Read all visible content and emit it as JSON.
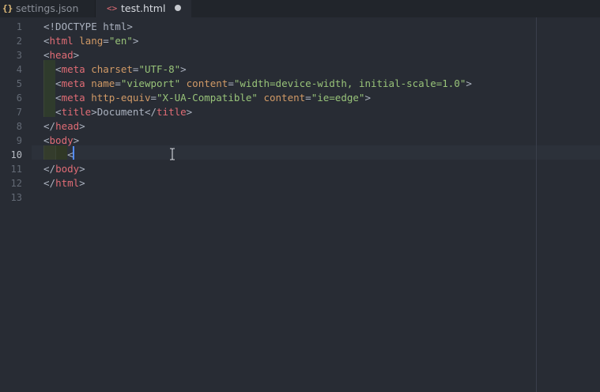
{
  "tabs": [
    {
      "label": "settings.json",
      "icon": "{}",
      "icon_name": "json-braces-icon",
      "active": false
    },
    {
      "label": "test.html",
      "icon": "<>",
      "icon_name": "html-code-icon",
      "active": true,
      "modified_indicator": "dirty-dot-icon"
    }
  ],
  "editor": {
    "active_line": 10,
    "line_numbers": [
      "1",
      "2",
      "3",
      "4",
      "5",
      "6",
      "7",
      "8",
      "9",
      "10",
      "11",
      "12",
      "13"
    ],
    "lines": [
      [
        {
          "c": "punct",
          "t": "<!DOCTYPE html>"
        }
      ],
      [
        {
          "c": "punct",
          "t": "<"
        },
        {
          "c": "tag",
          "t": "html"
        },
        {
          "c": "punct",
          "t": " "
        },
        {
          "c": "attr",
          "t": "lang"
        },
        {
          "c": "punct",
          "t": "="
        },
        {
          "c": "str",
          "t": "\"en\""
        },
        {
          "c": "punct",
          "t": ">"
        }
      ],
      [
        {
          "c": "punct",
          "t": "<"
        },
        {
          "c": "tag",
          "t": "head"
        },
        {
          "c": "punct",
          "t": ">"
        }
      ],
      [
        {
          "c": "punct",
          "t": "  <"
        },
        {
          "c": "tag",
          "t": "meta"
        },
        {
          "c": "punct",
          "t": " "
        },
        {
          "c": "attr",
          "t": "charset"
        },
        {
          "c": "punct",
          "t": "="
        },
        {
          "c": "str",
          "t": "\"UTF-8\""
        },
        {
          "c": "punct",
          "t": ">"
        }
      ],
      [
        {
          "c": "punct",
          "t": "  <"
        },
        {
          "c": "tag",
          "t": "meta"
        },
        {
          "c": "punct",
          "t": " "
        },
        {
          "c": "attr",
          "t": "name"
        },
        {
          "c": "punct",
          "t": "="
        },
        {
          "c": "str",
          "t": "\"viewport\""
        },
        {
          "c": "punct",
          "t": " "
        },
        {
          "c": "attr",
          "t": "content"
        },
        {
          "c": "punct",
          "t": "="
        },
        {
          "c": "str",
          "t": "\"width=device-width, initial-scale=1.0\""
        },
        {
          "c": "punct",
          "t": ">"
        }
      ],
      [
        {
          "c": "punct",
          "t": "  <"
        },
        {
          "c": "tag",
          "t": "meta"
        },
        {
          "c": "punct",
          "t": " "
        },
        {
          "c": "attr",
          "t": "http-equiv"
        },
        {
          "c": "punct",
          "t": "="
        },
        {
          "c": "str",
          "t": "\"X-UA-Compatible\""
        },
        {
          "c": "punct",
          "t": " "
        },
        {
          "c": "attr",
          "t": "content"
        },
        {
          "c": "punct",
          "t": "="
        },
        {
          "c": "str",
          "t": "\"ie=edge\""
        },
        {
          "c": "punct",
          "t": ">"
        }
      ],
      [
        {
          "c": "punct",
          "t": "  <"
        },
        {
          "c": "tag",
          "t": "title"
        },
        {
          "c": "punct",
          "t": ">"
        },
        {
          "c": "txt",
          "t": "Document"
        },
        {
          "c": "punct",
          "t": "</"
        },
        {
          "c": "tag",
          "t": "title"
        },
        {
          "c": "punct",
          "t": ">"
        }
      ],
      [
        {
          "c": "punct",
          "t": "</"
        },
        {
          "c": "tag",
          "t": "head"
        },
        {
          "c": "punct",
          "t": ">"
        }
      ],
      [
        {
          "c": "punct",
          "t": "<"
        },
        {
          "c": "tag",
          "t": "body"
        },
        {
          "c": "punct",
          "t": ">"
        }
      ],
      [
        {
          "c": "punct",
          "t": "    <"
        }
      ],
      [
        {
          "c": "punct",
          "t": "</"
        },
        {
          "c": "tag",
          "t": "body"
        },
        {
          "c": "punct",
          "t": ">"
        }
      ],
      [
        {
          "c": "punct",
          "t": "</"
        },
        {
          "c": "tag",
          "t": "html"
        },
        {
          "c": "punct",
          "t": ">"
        }
      ],
      []
    ]
  },
  "colors": {
    "background": "#282c34",
    "tab_bar": "#21252b",
    "tag": "#e06c75",
    "attribute": "#d19a66",
    "string": "#98c379",
    "text": "#abb2bf",
    "line_number": "#636a75",
    "caret": "#528bff"
  },
  "cursor_icon": "text-cursor-ibeam-icon"
}
